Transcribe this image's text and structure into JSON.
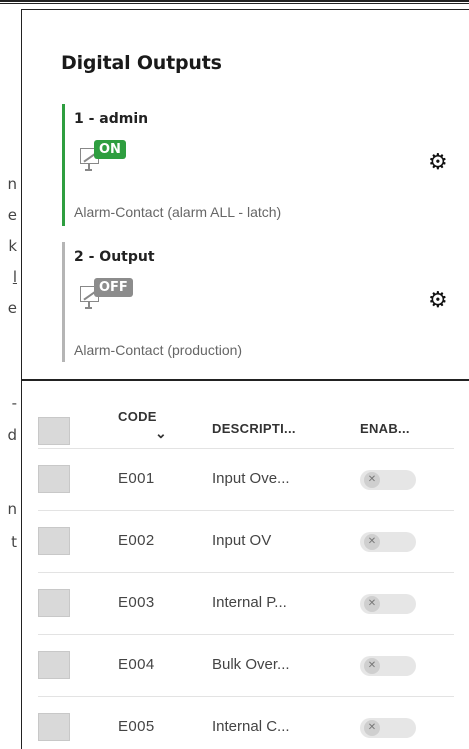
{
  "background_fragments": [
    "n",
    "e",
    "k",
    "l",
    "e",
    "-",
    "d",
    "n",
    "t"
  ],
  "digital_outputs": {
    "title": "Digital Outputs",
    "items": [
      {
        "name": "1 - admin",
        "state": "ON",
        "state_color": "#2e9e3f",
        "bar_color": "#2e9e3f",
        "description": "Alarm-Contact (alarm ALL - latch)"
      },
      {
        "name": "2 - Output",
        "state": "OFF",
        "state_color": "#8c8c8c",
        "bar_color": "#b5b5b5",
        "description": "Alarm-Contact (production)"
      }
    ]
  },
  "table": {
    "headers": {
      "code": "CODE",
      "sort_indicator": "⌄",
      "description": "DESCRIPTI...",
      "enabled": "ENAB..."
    },
    "rows": [
      {
        "code": "E001",
        "description": "Input Ove...",
        "enabled": false
      },
      {
        "code": "E002",
        "description": "Input OV",
        "enabled": false
      },
      {
        "code": "E003",
        "description": "Internal P...",
        "enabled": false
      },
      {
        "code": "E004",
        "description": "Bulk Over...",
        "enabled": false
      },
      {
        "code": "E005",
        "description": "Internal C...",
        "enabled": false
      }
    ]
  },
  "icons": {
    "settings": "gear-icon",
    "relay": "relay-contact-icon",
    "toggle_off": "x-icon"
  }
}
